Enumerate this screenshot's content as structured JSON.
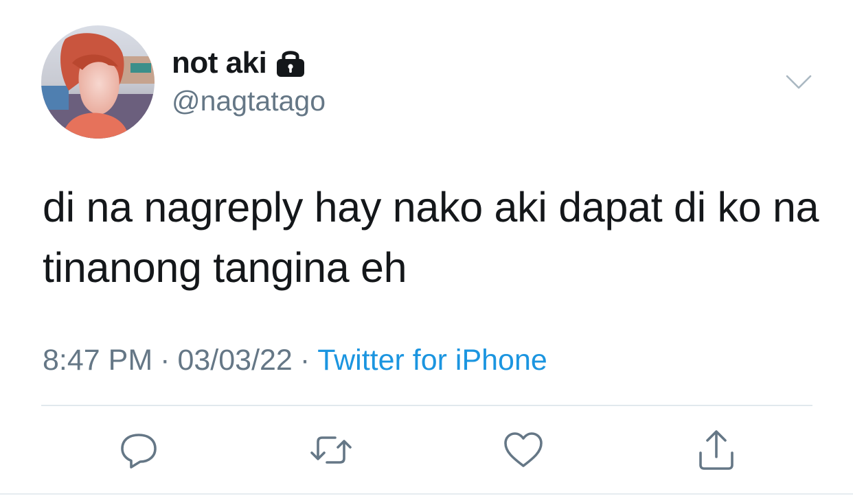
{
  "user": {
    "display_name": "not aki",
    "handle": "@nagtatago",
    "protected_icon": "lock-icon",
    "avatar_description": "profile photo"
  },
  "tweet": {
    "text": "di na nagreply hay nako aki dapat di ko na tinanong tangina eh",
    "time": "8:47 PM",
    "date": "03/03/22",
    "separator": "·",
    "source": "Twitter for iPhone"
  },
  "actions": {
    "reply_icon": "reply-icon",
    "retweet_icon": "retweet-icon",
    "like_icon": "heart-icon",
    "share_icon": "share-icon",
    "menu_icon": "chevron-down-icon"
  },
  "colors": {
    "text": "#14171a",
    "secondary": "#657786",
    "link": "#1b95e0",
    "divider": "#e1e8ed"
  }
}
